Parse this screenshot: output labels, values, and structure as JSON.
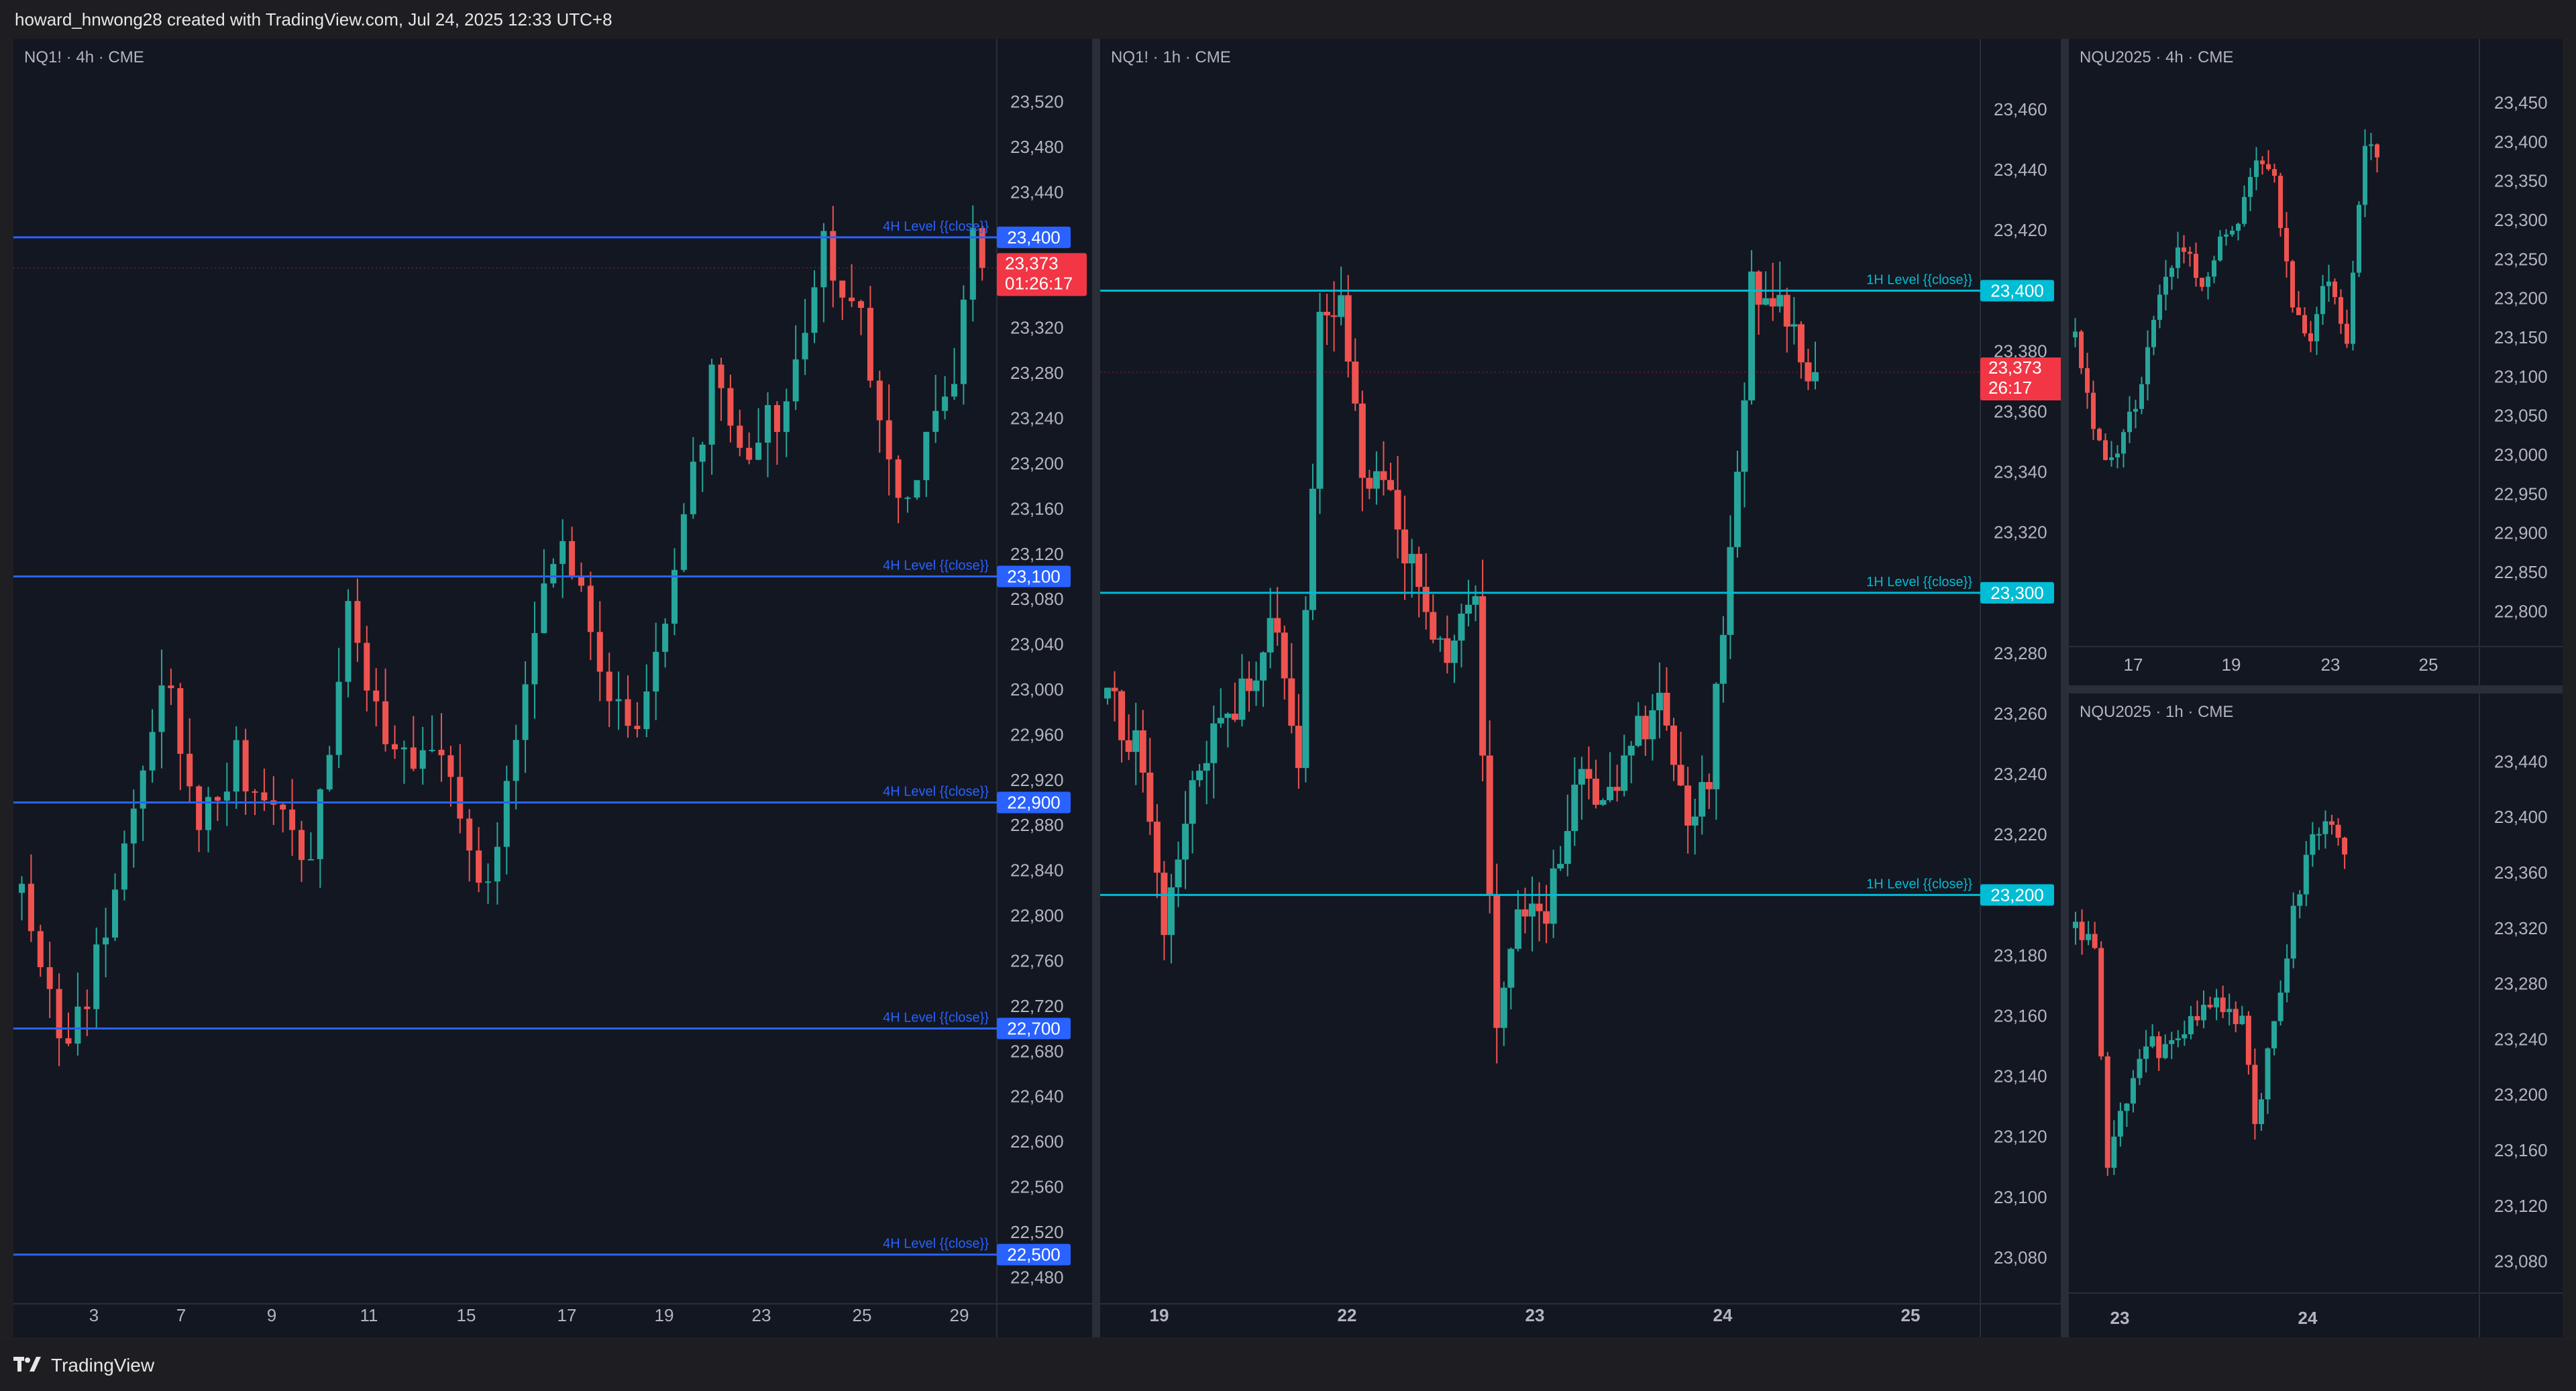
{
  "header": {
    "attribution": "howard_hnwong28 created with TradingView.com, Jul 24, 2025 12:33 UTC+8"
  },
  "footer": {
    "brand": "TradingView"
  },
  "colors": {
    "bull": "#26a69a",
    "bear": "#ef5350",
    "background": "#131722",
    "level_4h": "#2962ff",
    "level_1h": "#00bcd4",
    "price_tag": "#f23645"
  },
  "icons": {
    "brand": "tradingview-logo-icon"
  },
  "panels": [
    {
      "id": "nq1-4h",
      "title": "NQ1! · 4h · CME",
      "y_ticks": [
        "23,520",
        "23,480",
        "23,440",
        "23,320",
        "23,280",
        "23,240",
        "23,200",
        "23,160",
        "23,120",
        "23,080",
        "23,040",
        "23,000",
        "22,960",
        "22,920",
        "22,880",
        "22,840",
        "22,800",
        "22,760",
        "22,720",
        "22,680",
        "22,640",
        "22,600",
        "22,560",
        "22,520",
        "22,480"
      ],
      "x_ticks": [
        "3",
        "7",
        "9",
        "11",
        "15",
        "17",
        "19",
        "23",
        "25",
        "29"
      ],
      "levels": [
        {
          "price": 23400,
          "label": "4H Level {{close}}",
          "tag": "23,400"
        },
        {
          "price": 23100,
          "label": "4H Level {{close}}",
          "tag": "23,100"
        },
        {
          "price": 22900,
          "label": "4H Level {{close}}",
          "tag": "22,900"
        },
        {
          "price": 22700,
          "label": "4H Level {{close}}",
          "tag": "22,700"
        },
        {
          "price": 22500,
          "label": "4H Level {{close}}",
          "tag": "22,500"
        }
      ],
      "last_price": {
        "price": "23,373",
        "countdown": "01:26:17"
      },
      "chart_data": {
        "type": "candlestick",
        "y_range": [
          22460,
          23540
        ],
        "anchors": [
          [
            0,
            22820
          ],
          [
            5,
            22680
          ],
          [
            8,
            22760
          ],
          [
            12,
            22890
          ],
          [
            15,
            23020
          ],
          [
            19,
            22890
          ],
          [
            23,
            22940
          ],
          [
            27,
            22880
          ],
          [
            31,
            22860
          ],
          [
            35,
            23060
          ],
          [
            40,
            22930
          ],
          [
            44,
            22960
          ],
          [
            50,
            22820
          ],
          [
            54,
            23000
          ],
          [
            58,
            23150
          ],
          [
            62,
            23000
          ],
          [
            66,
            22960
          ],
          [
            70,
            23100
          ],
          [
            74,
            23270
          ],
          [
            78,
            23220
          ],
          [
            82,
            23250
          ],
          [
            86,
            23390
          ],
          [
            90,
            23320
          ],
          [
            94,
            23170
          ],
          [
            98,
            23230
          ],
          [
            100,
            23280
          ],
          [
            102,
            23390
          ],
          [
            103,
            23373
          ]
        ],
        "count": 104
      }
    },
    {
      "id": "nq1-1h",
      "title": "NQ1! · 1h · CME",
      "y_ticks": [
        "23,460",
        "23,440",
        "23,420",
        "23,380",
        "23,360",
        "23,340",
        "23,320",
        "23,280",
        "23,260",
        "23,240",
        "23,220",
        "23,180",
        "23,160",
        "23,140",
        "23,120",
        "23,100",
        "23,080"
      ],
      "x_ticks": [
        "19",
        "22",
        "23",
        "24",
        "25"
      ],
      "levels": [
        {
          "price": 23400,
          "label": "1H Level {{close}}",
          "tag": "23,400"
        },
        {
          "price": 23300,
          "label": "1H Level {{close}}",
          "tag": "23,300"
        },
        {
          "price": 23200,
          "label": "1H Level {{close}}",
          "tag": "23,200"
        }
      ],
      "last_price": {
        "price": "23,373",
        "countdown": "26:17"
      },
      "chart_data": {
        "type": "candlestick",
        "y_range": [
          23066,
          23470
        ],
        "anchors": [
          [
            0,
            23265
          ],
          [
            4,
            23250
          ],
          [
            8,
            23190
          ],
          [
            12,
            23235
          ],
          [
            16,
            23255
          ],
          [
            20,
            23270
          ],
          [
            24,
            23290
          ],
          [
            27,
            23240
          ],
          [
            30,
            23390
          ],
          [
            33,
            23400
          ],
          [
            36,
            23340
          ],
          [
            40,
            23330
          ],
          [
            44,
            23300
          ],
          [
            48,
            23280
          ],
          [
            52,
            23300
          ],
          [
            55,
            23150
          ],
          [
            58,
            23200
          ],
          [
            62,
            23190
          ],
          [
            66,
            23240
          ],
          [
            70,
            23230
          ],
          [
            74,
            23250
          ],
          [
            78,
            23260
          ],
          [
            82,
            23220
          ],
          [
            85,
            23240
          ],
          [
            88,
            23310
          ],
          [
            91,
            23400
          ],
          [
            94,
            23395
          ],
          [
            97,
            23390
          ],
          [
            99,
            23375
          ],
          [
            100,
            23373
          ]
        ],
        "count": 101
      }
    },
    {
      "id": "nqu2025-4h",
      "title": "NQU2025 · 4h · CME",
      "y_ticks": [
        "23,450",
        "23,400",
        "23,350",
        "23,300",
        "23,250",
        "23,200",
        "23,150",
        "23,100",
        "23,050",
        "23,000",
        "22,950",
        "22,900",
        "22,850",
        "22,800"
      ],
      "x_ticks": [
        "17",
        "19",
        "23",
        "25"
      ],
      "chart_data": {
        "type": "candlestick",
        "y_range": [
          22760,
          23480
        ],
        "anchors": [
          [
            0,
            23150
          ],
          [
            3,
            23030
          ],
          [
            6,
            22990
          ],
          [
            10,
            23060
          ],
          [
            14,
            23200
          ],
          [
            18,
            23270
          ],
          [
            21,
            23220
          ],
          [
            24,
            23280
          ],
          [
            27,
            23300
          ],
          [
            30,
            23380
          ],
          [
            33,
            23350
          ],
          [
            36,
            23200
          ],
          [
            39,
            23150
          ],
          [
            42,
            23230
          ],
          [
            45,
            23150
          ],
          [
            48,
            23400
          ],
          [
            50,
            23380
          ]
        ],
        "count": 51
      }
    },
    {
      "id": "nqu2025-1h",
      "title": "NQU2025 · 1h · CME",
      "y_ticks": [
        "23,440",
        "23,400",
        "23,360",
        "23,320",
        "23,280",
        "23,240",
        "23,200",
        "23,160",
        "23,120",
        "23,080"
      ],
      "x_ticks": [
        "23",
        "24"
      ],
      "chart_data": {
        "type": "candlestick",
        "y_range": [
          23060,
          23460
        ],
        "anchors": [
          [
            0,
            23320
          ],
          [
            3,
            23310
          ],
          [
            5,
            23150
          ],
          [
            8,
            23200
          ],
          [
            11,
            23240
          ],
          [
            14,
            23230
          ],
          [
            18,
            23250
          ],
          [
            22,
            23270
          ],
          [
            26,
            23250
          ],
          [
            28,
            23180
          ],
          [
            31,
            23250
          ],
          [
            34,
            23330
          ],
          [
            37,
            23390
          ],
          [
            40,
            23395
          ],
          [
            42,
            23373
          ]
        ],
        "count": 43
      }
    }
  ]
}
